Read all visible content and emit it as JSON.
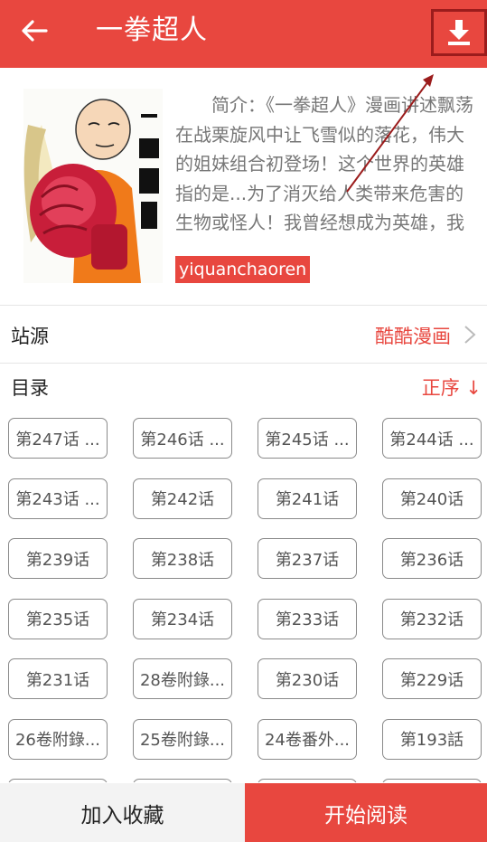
{
  "header": {
    "title": "一拳超人",
    "back_icon": "back-arrow-icon",
    "download_icon": "download-icon",
    "color": "#e8473f"
  },
  "info": {
    "description": "简介：《一拳超人》漫画讲述飘荡在战栗旋风中让飞雪似的落花，伟大的姐妹组合初登场！这个世界的英雄指的是...为了消灭给人类带来危害的生物或怪人！我曾经想成为英雄，我想拯救时间奈何...",
    "pinyin": "yiquanchaoren"
  },
  "source": {
    "label": "站源",
    "value": "酷酷漫画"
  },
  "catalog": {
    "label": "目录",
    "order": "正序 ↓"
  },
  "chapters": [
    "第247话 ...",
    "第246话 ...",
    "第245话 ...",
    "第244话 ...",
    "第243话 ...",
    "第242话",
    "第241话",
    "第240话",
    "第239话",
    "第238话",
    "第237话",
    "第236话",
    "第235话",
    "第234话",
    "第233话",
    "第232话",
    "第231话",
    "28卷附錄...",
    "第230话",
    "第229话",
    "26卷附錄...",
    "25卷附錄...",
    "24卷番外...",
    "第193話",
    "",
    "",
    "",
    ""
  ],
  "bottom": {
    "favorite": "加入收藏",
    "read": "开始阅读"
  }
}
